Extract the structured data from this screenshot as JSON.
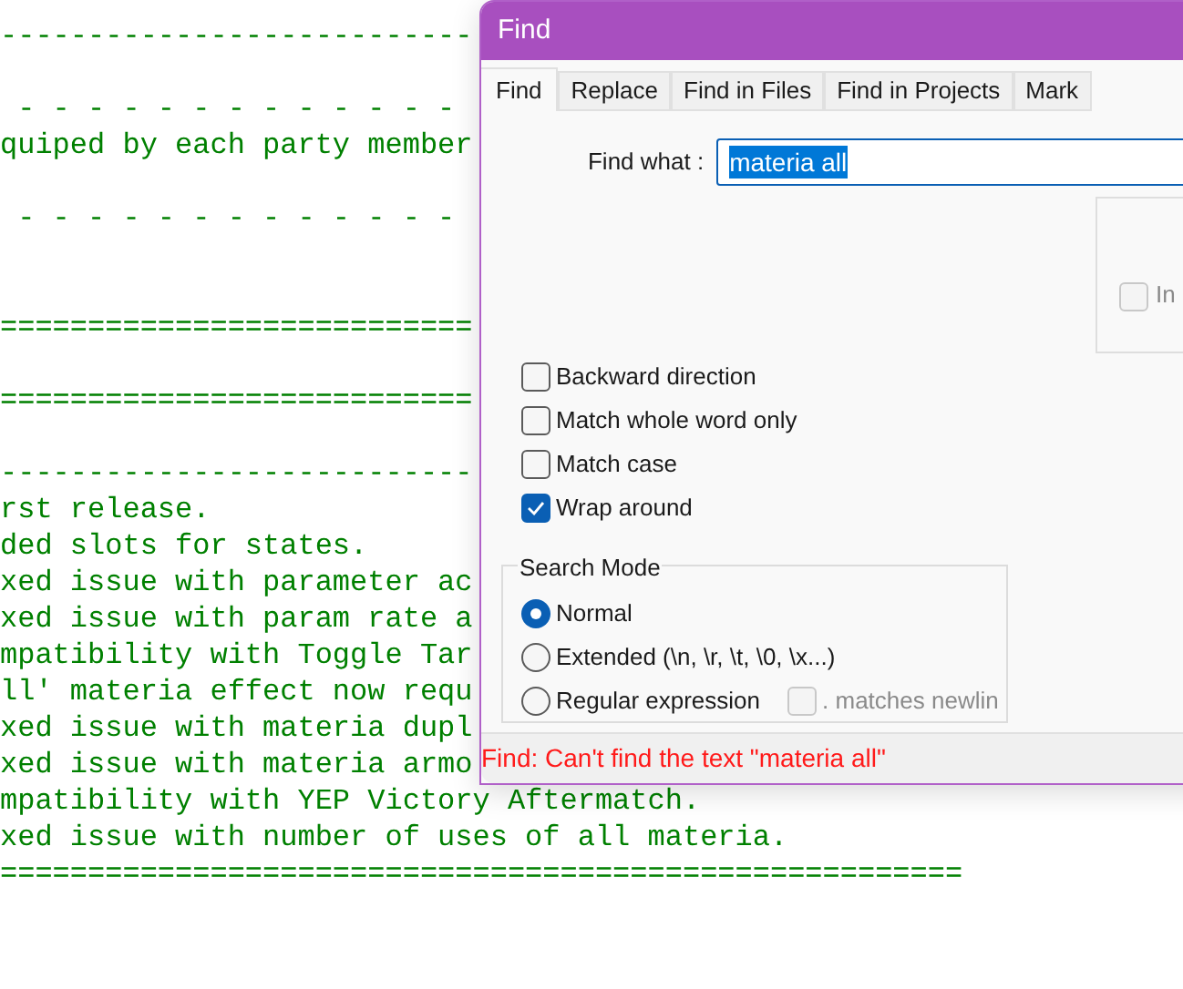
{
  "editor": {
    "lines": [
      {
        "kind": "text",
        "text": "---------------------------"
      },
      {
        "kind": "blank"
      },
      {
        "kind": "text",
        "text": " - - - - - - - - - - - - -"
      },
      {
        "kind": "text",
        "text": "quiped by each party member"
      },
      {
        "kind": "blank"
      },
      {
        "kind": "text",
        "text": " - - - - - - - - - - - - -"
      },
      {
        "kind": "blank"
      },
      {
        "kind": "blank"
      },
      {
        "kind": "text",
        "text": "==========================="
      },
      {
        "kind": "blank"
      },
      {
        "kind": "text",
        "text": "==========================="
      },
      {
        "kind": "blank"
      },
      {
        "kind": "text",
        "text": "---------------------------"
      },
      {
        "kind": "text",
        "text": "rst release."
      },
      {
        "kind": "text",
        "text": "ded slots for states."
      },
      {
        "kind": "text",
        "text": "xed issue with parameter ac"
      },
      {
        "kind": "text",
        "text": "xed issue with param rate a"
      },
      {
        "kind": "text",
        "text": "mpatibility with Toggle Tar"
      },
      {
        "kind": "text",
        "text": "ll' materia effect now requ"
      },
      {
        "kind": "text",
        "text": "xed issue with materia dupl"
      },
      {
        "kind": "text",
        "text": "xed issue with materia armo"
      },
      {
        "kind": "text",
        "text": "mpatibility with YEP Victory Aftermatch."
      },
      {
        "kind": "text",
        "text": "xed issue with number of uses of all materia."
      },
      {
        "kind": "text",
        "text": "======================================================="
      }
    ]
  },
  "dialog": {
    "title": "Find",
    "tabs": [
      {
        "label": "Find",
        "selected": true
      },
      {
        "label": "Replace",
        "selected": false
      },
      {
        "label": "Find in Files",
        "selected": false
      },
      {
        "label": "Find in Projects",
        "selected": false
      },
      {
        "label": "Mark",
        "selected": false
      }
    ],
    "find_what": {
      "label": "Find what :",
      "value": "materia all"
    },
    "in_selection": {
      "label": "In",
      "checked": false,
      "disabled": true
    },
    "options": [
      {
        "label": "Backward direction",
        "checked": false
      },
      {
        "label": "Match whole word only",
        "checked": false
      },
      {
        "label": "Match case",
        "checked": false
      },
      {
        "label": "Wrap around",
        "checked": true
      }
    ],
    "search_mode": {
      "title": "Search Mode",
      "modes": [
        {
          "label": "Normal",
          "selected": true
        },
        {
          "label": "Extended (\\n, \\r, \\t, \\0, \\x...)",
          "selected": false
        },
        {
          "label": "Regular expression",
          "selected": false
        }
      ],
      "matches_newline": {
        "label": ". matches newlin",
        "checked": false,
        "disabled": true
      }
    },
    "status": "Find: Can't find the text \"materia all\""
  }
}
